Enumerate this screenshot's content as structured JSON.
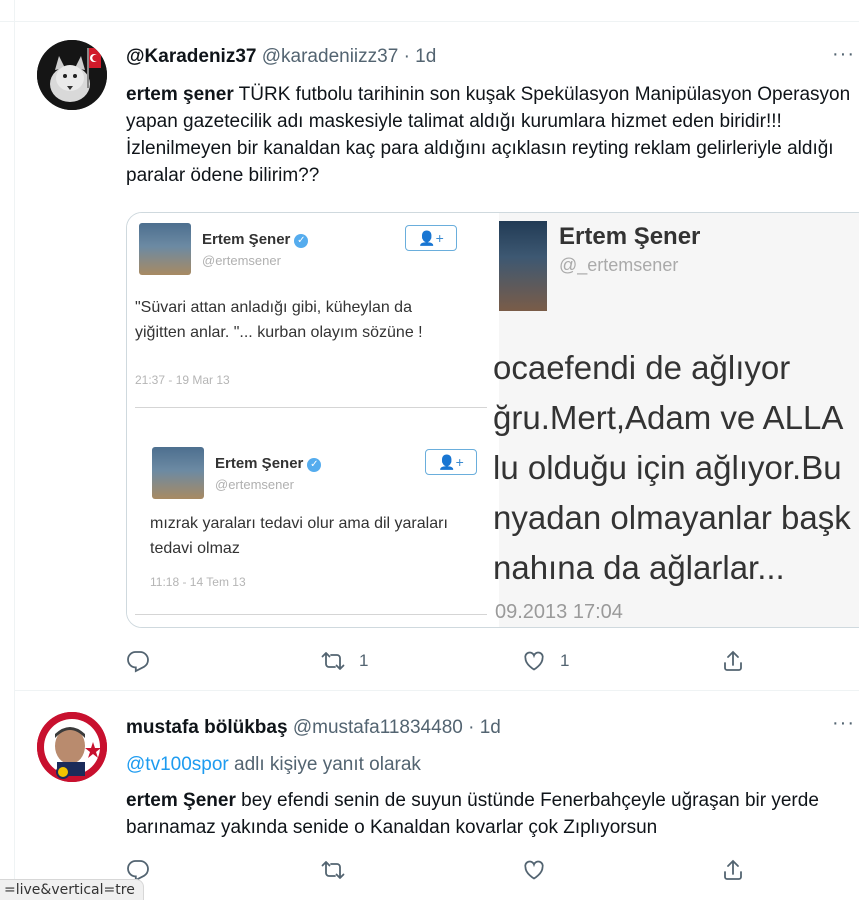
{
  "tweets": [
    {
      "display_name": "@Karadeniz37",
      "handle": "@karadeniizz37",
      "time": "· 1d",
      "more_label": "···",
      "body_bold": "ertem şener",
      "body_text": " TÜRK futbolu tarihinin son kuşak Spekülasyon Manipülasyon Operasyon yapan gazetecilik adı maskesiyle talimat aldığı kurumlara hizmet eden biridir!!! İzlenilmeyen bir kanaldan kaç para aldığını açıklasın reyting reklam gelirleriyle aldığı paralar ödene bilirim??",
      "media": {
        "left_cards": [
          {
            "name": "Ertem Şener",
            "verified": "✓",
            "handle": "@ertemsener",
            "follow": "👤+",
            "text": "\"Süvari attan anladığı gibi, küheylan da yiğitten anlar. \"... kurban olayım sözüne !",
            "time": "21:37 - 19 Mar 13"
          },
          {
            "name": "Ertem Şener",
            "verified": "✓",
            "handle": "@ertemsener",
            "follow": "👤+",
            "text": "mızrak yaraları tedavi olur ama dil yaraları tedavi olmaz",
            "time": "11:18 - 14 Tem 13"
          }
        ],
        "right": {
          "name": "Ertem Şener",
          "handle": "@_ertemsener",
          "lines": [
            "ocaefendi de ağlıyor",
            "ğru.Mert,Adam ve ALLA",
            "lu olduğu için ağlıyor.Bu",
            "nyadan olmayanlar başk",
            "nahına da ağlarlar..."
          ],
          "time": "09.2013 17:04"
        }
      },
      "actions": {
        "replies": "",
        "retweets": "1",
        "likes": "1"
      }
    },
    {
      "display_name": "mustafa bölükbaş",
      "handle": "@mustafa11834480",
      "time": "· 1d",
      "more_label": "···",
      "reply_to_mention": "@tv100spor",
      "reply_to_suffix": " adlı kişiye yanıt olarak",
      "body_bold": "ertem Şener",
      "body_text": " bey efendi senin de suyun üstünde Fenerbahçeyle uğraşan bir yerde barınamaz yakında senide o Kanaldan kovarlar çok Zıplıyorsun",
      "actions": {
        "replies": "",
        "retweets": "",
        "likes": ""
      }
    }
  ],
  "status_bar": {
    "url": "=live&vertical=tre"
  },
  "colors": {
    "accent": "#1d9bf0",
    "muted": "#536471",
    "border": "#eff3f4"
  },
  "icons": [
    "reply-icon",
    "retweet-icon",
    "like-icon",
    "share-icon",
    "more-icon",
    "verified-icon"
  ]
}
